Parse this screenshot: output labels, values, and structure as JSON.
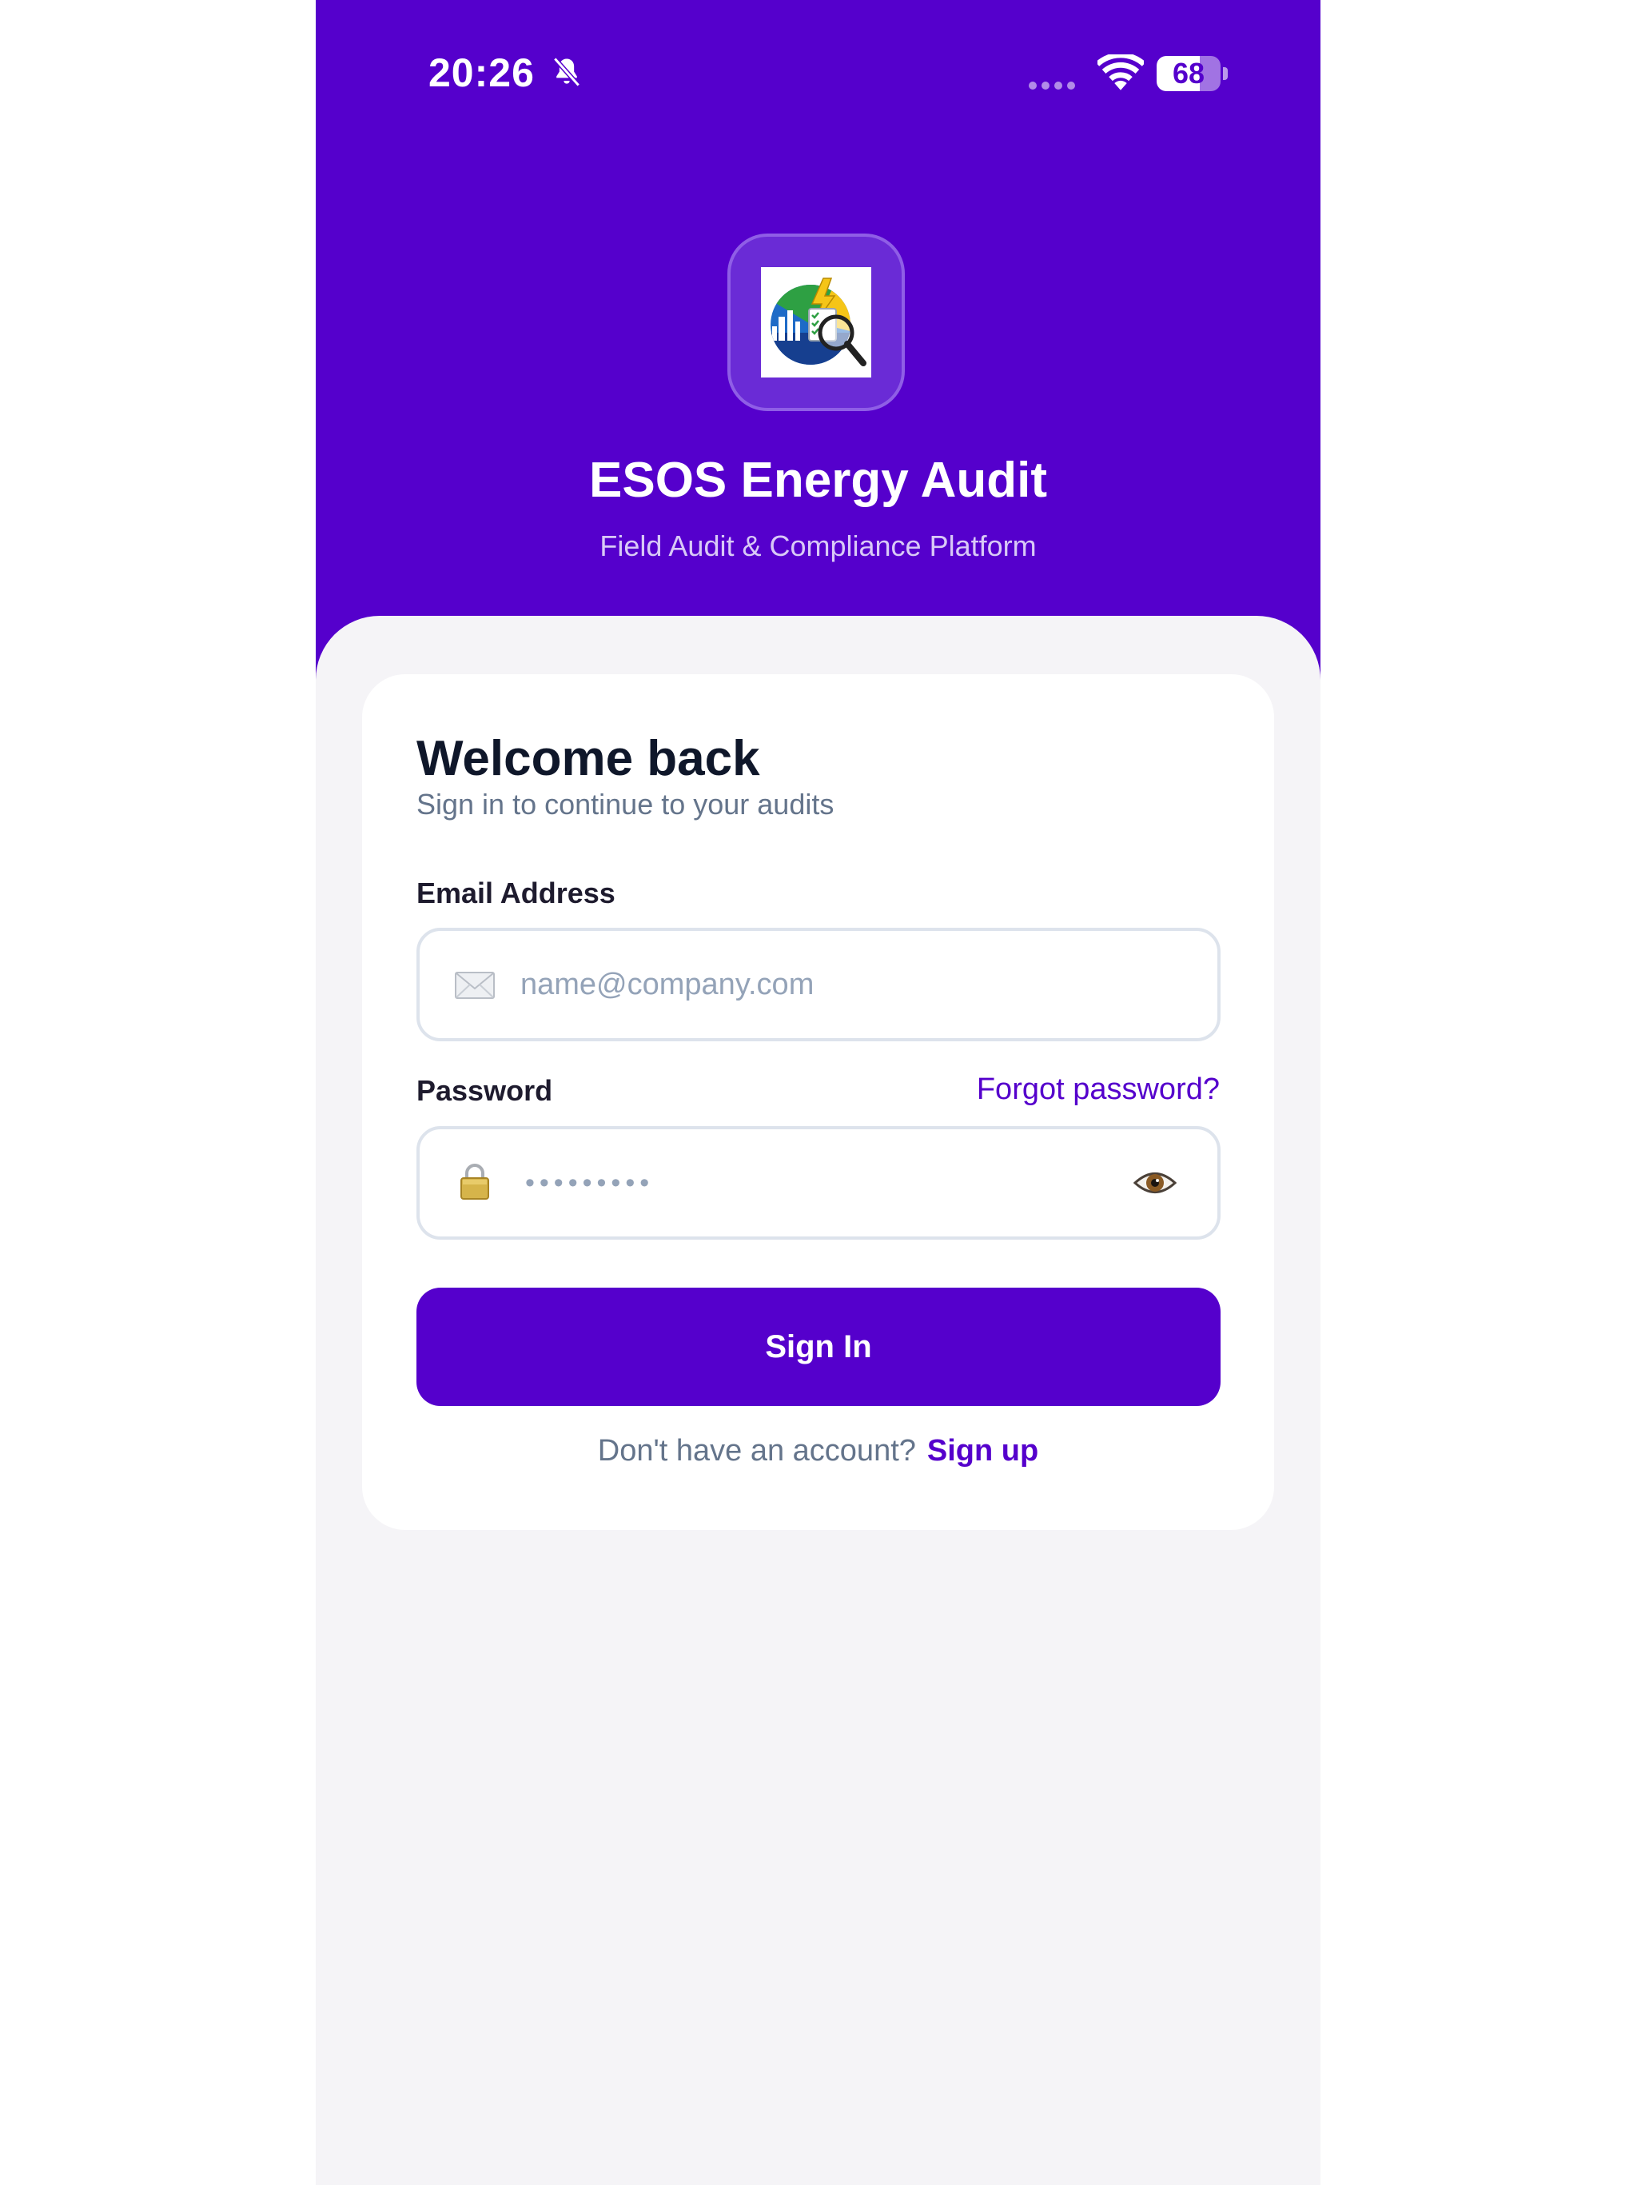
{
  "status_bar": {
    "time": "20:26",
    "battery_level": "68",
    "battery_fraction": 0.68
  },
  "header": {
    "app_title": "ESOS Energy Audit",
    "app_subtitle": "Field Audit & Compliance Platform"
  },
  "login_card": {
    "title": "Welcome back",
    "subtitle": "Sign in to continue to your audits",
    "email": {
      "label": "Email Address",
      "placeholder": "name@company.com",
      "value": ""
    },
    "password": {
      "label": "Password",
      "masked_value": "•••••••••",
      "forgot_label": "Forgot password?"
    },
    "sign_in_label": "Sign In",
    "signup_prompt": "Don't have an account?",
    "signup_link": "Sign up"
  },
  "icons": {
    "status": [
      "bell-slash-icon",
      "cellular-signal-icon",
      "wifi-icon",
      "battery-icon"
    ],
    "email_field": "envelope-icon",
    "password_field": "padlock-icon",
    "password_toggle": "eye-icon"
  },
  "colors": {
    "brand_primary": "#5500cc",
    "background": "#f5f4f7",
    "card": "#ffffff",
    "heading": "#0f172a",
    "muted_text": "#64748b",
    "input_border": "#dde3ec"
  }
}
